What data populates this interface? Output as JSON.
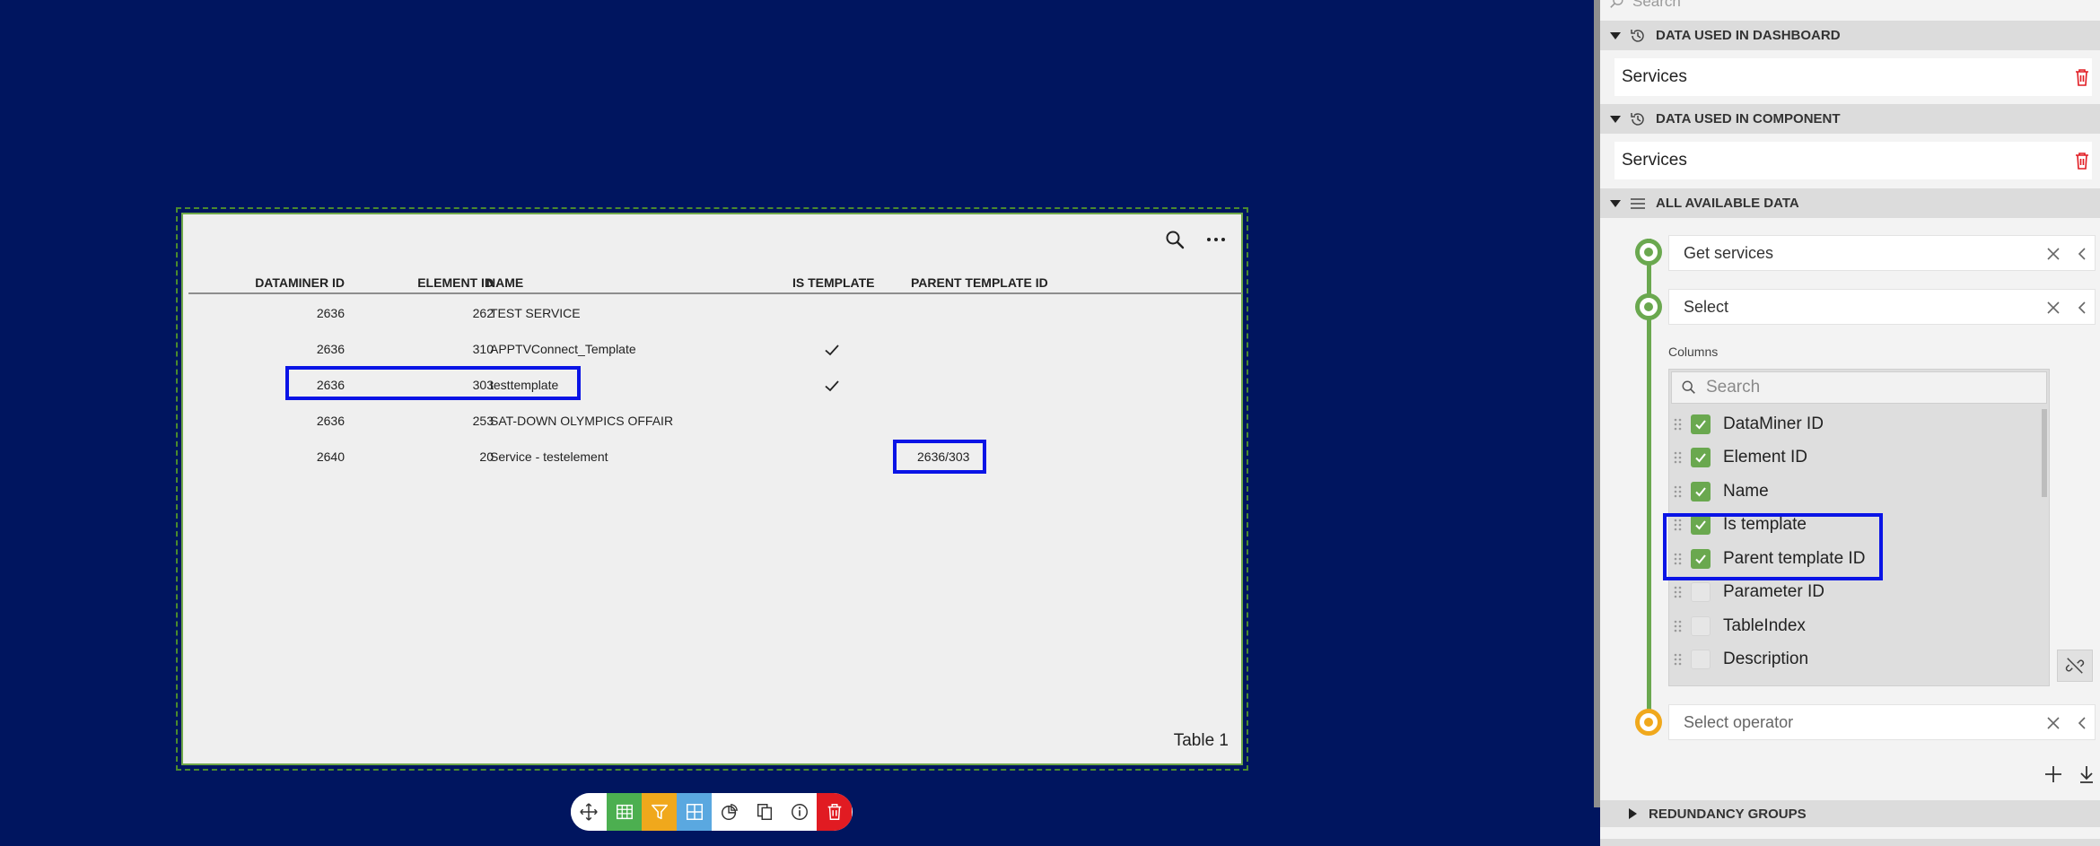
{
  "table": {
    "columns": [
      "DATAMINER ID",
      "ELEMENT ID",
      "NAME",
      "IS TEMPLATE",
      "PARENT TEMPLATE ID"
    ],
    "rows": [
      {
        "dataminer_id": "2636",
        "element_id": "262",
        "name": "TEST SERVICE",
        "is_template": false,
        "parent_template_id": ""
      },
      {
        "dataminer_id": "2636",
        "element_id": "310",
        "name": "APPTVConnect_Template",
        "is_template": true,
        "parent_template_id": ""
      },
      {
        "dataminer_id": "2636",
        "element_id": "303",
        "name": "testtemplate",
        "is_template": true,
        "parent_template_id": ""
      },
      {
        "dataminer_id": "2636",
        "element_id": "253",
        "name": "SAT-DOWN OLYMPICS OFFAIR",
        "is_template": false,
        "parent_template_id": ""
      },
      {
        "dataminer_id": "2640",
        "element_id": "20",
        "name": "Service - testelement",
        "is_template": false,
        "parent_template_id": "2636/303"
      }
    ],
    "label": "Table 1",
    "icons": {
      "search": "search-icon",
      "more": "more-horizontal-icon",
      "check": "checkmark-icon"
    }
  },
  "toolbar": {
    "buttons": [
      {
        "name": "move-button",
        "icon": "move-icon",
        "bg": "#ffffff"
      },
      {
        "name": "table-view-button",
        "icon": "table-icon",
        "bg": "#4caf50"
      },
      {
        "name": "filter-button",
        "icon": "filter-icon",
        "bg": "#f0a81c"
      },
      {
        "name": "grid-view-button",
        "icon": "grid-icon",
        "bg": "#5aa8e0"
      },
      {
        "name": "chart-button",
        "icon": "pie-chart-icon",
        "bg": "#ffffff"
      },
      {
        "name": "duplicate-button",
        "icon": "copy-icon",
        "bg": "#ffffff"
      },
      {
        "name": "info-button",
        "icon": "info-icon",
        "bg": "#ffffff"
      },
      {
        "name": "delete-button",
        "icon": "trash-icon",
        "bg": "#e11b22"
      }
    ]
  },
  "panel": {
    "search_placeholder": "Search",
    "sections": {
      "dashboard": "DATA USED IN DASHBOARD",
      "component": "DATA USED IN COMPONENT",
      "available": "ALL AVAILABLE DATA",
      "redundancy": "REDUNDANCY GROUPS"
    },
    "dashboard_item": "Services",
    "component_item": "Services",
    "pipeline": {
      "steps": [
        "Get services",
        "Select"
      ],
      "operator_placeholder": "Select operator",
      "columns_label": "Columns",
      "columns_search_placeholder": "Search",
      "columns": [
        {
          "label": "DataMiner ID",
          "checked": true
        },
        {
          "label": "Element ID",
          "checked": true
        },
        {
          "label": "Name",
          "checked": true
        },
        {
          "label": "Is template",
          "checked": true
        },
        {
          "label": "Parent template ID",
          "checked": true
        },
        {
          "label": "Parameter ID",
          "checked": false
        },
        {
          "label": "TableIndex",
          "checked": false
        },
        {
          "label": "Description",
          "checked": false
        }
      ]
    }
  },
  "colors": {
    "canvas_bg": "#00155f",
    "highlight": "#0a14e6",
    "accent_green": "#6aa84f",
    "accent_orange": "#f0a81c",
    "delete_red": "#e11b22"
  }
}
